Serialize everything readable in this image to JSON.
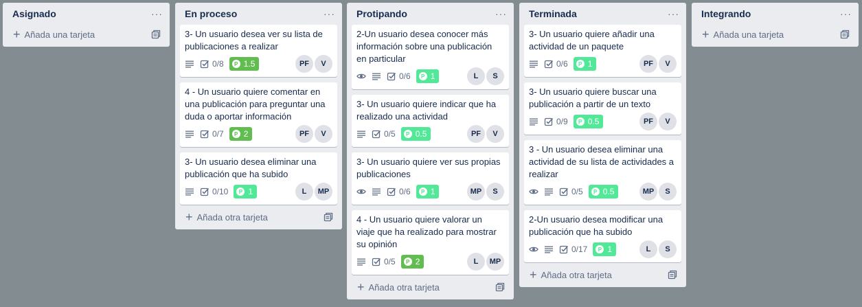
{
  "colors": {
    "board_bg": "#838c91",
    "list_bg": "#ebecf0",
    "points_green": "#61bd4f",
    "points_light_green": "#51e898"
  },
  "icons": {
    "menu": "ellipsis-icon",
    "plus": "plus-icon",
    "template": "card-template-icon",
    "description": "description-icon",
    "checklist": "checklist-icon",
    "watch": "eye-icon",
    "points": "points-icon"
  },
  "lists": [
    {
      "title": "Asignado",
      "menu": "···",
      "add_label": "Añada una tarjeta",
      "cards": []
    },
    {
      "title": "En proceso",
      "menu": "···",
      "add_label": "Añada otra tarjeta",
      "cards": [
        {
          "title": "3- Un usuario desea ver su lista de publicaciones a realizar",
          "watch": false,
          "checklist": "0/8",
          "points": "1.5",
          "points_style": "dark",
          "members": [
            "PF",
            "V"
          ]
        },
        {
          "title": "4 - Un usuario quiere comentar en una publicación para preguntar una duda o aportar información",
          "watch": false,
          "checklist": "0/7",
          "points": "2",
          "points_style": "dark",
          "members": [
            "PF",
            "V"
          ]
        },
        {
          "title": "3- Un usuario desea eliminar una publicación que ha subido",
          "watch": false,
          "checklist": "0/10",
          "points": "1",
          "points_style": "light",
          "members": [
            "L",
            "MP"
          ]
        }
      ]
    },
    {
      "title": "Protipando",
      "menu": "···",
      "add_label": "Añada otra tarjeta",
      "cards": [
        {
          "title": "2-Un usuario desea conocer más información sobre una publicación en particular",
          "watch": true,
          "checklist": "0/6",
          "points": "1",
          "points_style": "light",
          "members": [
            "L",
            "S"
          ]
        },
        {
          "title": "3- Un usuario quiere indicar que ha realizado una actividad",
          "watch": false,
          "checklist": "0/5",
          "points": "0.5",
          "points_style": "light",
          "members": [
            "PF",
            "V"
          ]
        },
        {
          "title": "3- Un usuario quiere ver sus propias publicaciones",
          "watch": true,
          "checklist": "0/6",
          "points": "1",
          "points_style": "light",
          "members": [
            "MP",
            "S"
          ]
        },
        {
          "title": "4 - Un usuario quiere valorar un viaje que ha realizado para mostrar su opinión",
          "watch": false,
          "checklist": "0/5",
          "points": "2",
          "points_style": "dark",
          "members": [
            "L",
            "MP"
          ]
        }
      ]
    },
    {
      "title": "Terminada",
      "menu": "···",
      "add_label": "Añada otra tarjeta",
      "cards": [
        {
          "title": "3- Un usuario quiere añadir una actividad de un paquete",
          "watch": false,
          "checklist": "0/6",
          "points": "1",
          "points_style": "light",
          "members": [
            "PF",
            "V"
          ]
        },
        {
          "title": "3- Un usuario quiere buscar una publicación a partir de un texto",
          "watch": false,
          "checklist": "0/9",
          "points": "0.5",
          "points_style": "light",
          "members": [
            "PF",
            "V"
          ]
        },
        {
          "title": "3 - Un usuario desea eliminar una actividad de su lista de actividades a realizar",
          "watch": true,
          "checklist": "0/5",
          "points": "0.5",
          "points_style": "light",
          "members": [
            "MP",
            "S"
          ]
        },
        {
          "title": "2-Un usuario desea modificar una publicación que ha subido",
          "watch": true,
          "checklist": "0/17",
          "points": "1",
          "points_style": "light",
          "members": [
            "L",
            "S"
          ]
        }
      ]
    },
    {
      "title": "Integrando",
      "menu": "···",
      "add_label": "Añada una tarjeta",
      "cards": []
    }
  ]
}
